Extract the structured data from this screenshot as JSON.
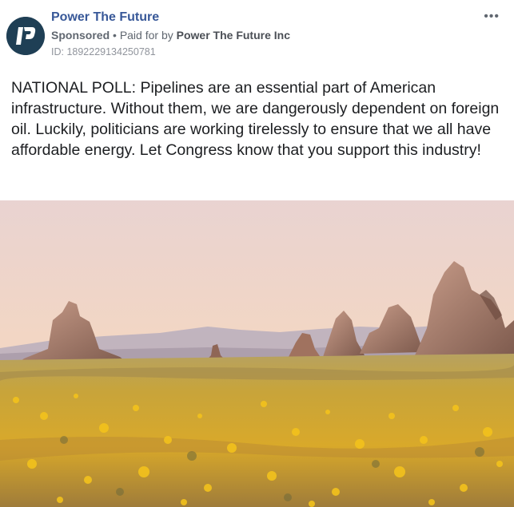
{
  "post": {
    "page_name": "Power The Future",
    "sponsored_label": "Sponsored",
    "separator": "•",
    "paid_for_label": "Paid for by",
    "payer": "Power The Future Inc",
    "ad_id": "ID: 1892229134250781",
    "more_icon": "ellipsis-icon",
    "text": "NATIONAL POLL: Pipelines are an essential part of American infrastructure. Without them, we are dangerously dependent on foreign oil. Luckily, politicians are working tirelessly to ensure that we all have affordable energy. Let Congress know that you support this industry!"
  },
  "colors": {
    "page_name": "#385898",
    "avatar_bg": "#1f3f55",
    "secondary_text": "#606770",
    "body_text": "#1c1e21"
  },
  "image": {
    "subject": "desert landscape with rock pinnacles and yellow wildflowers at dusk"
  }
}
